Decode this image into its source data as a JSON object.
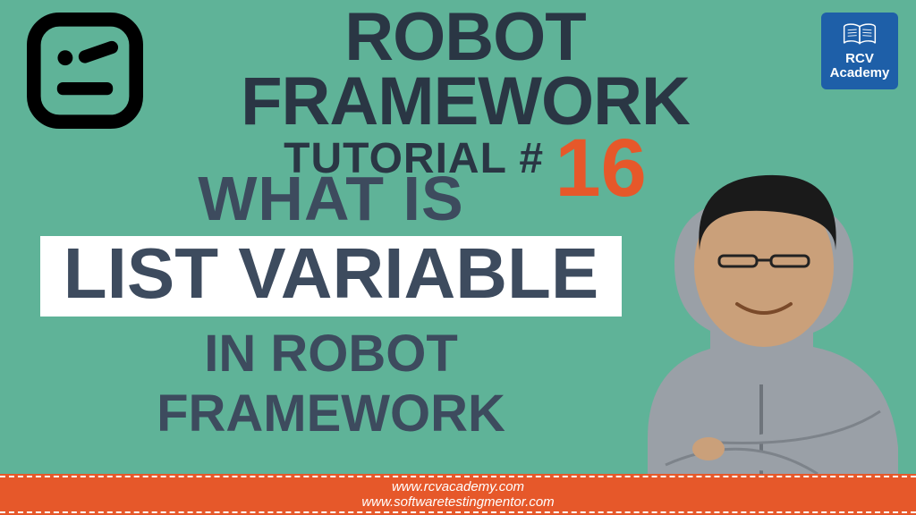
{
  "header": {
    "title_line1": "ROBOT FRAMEWORK",
    "title_line2": "TUTORIAL #",
    "tutorial_number": "16"
  },
  "badge": {
    "line1": "RCV",
    "line2": "Academy"
  },
  "subtitle": {
    "line1": "WHAT IS",
    "highlight": "LIST VARIABLE",
    "line3": "IN ROBOT FRAMEWORK"
  },
  "footer": {
    "url1": "www.rcvacademy.com",
    "url2": "www.softwaretestingmentor.com"
  },
  "colors": {
    "bg": "#5fb398",
    "accent": "#e6582a",
    "dark": "#2a3644",
    "badge": "#1e5fa8"
  }
}
